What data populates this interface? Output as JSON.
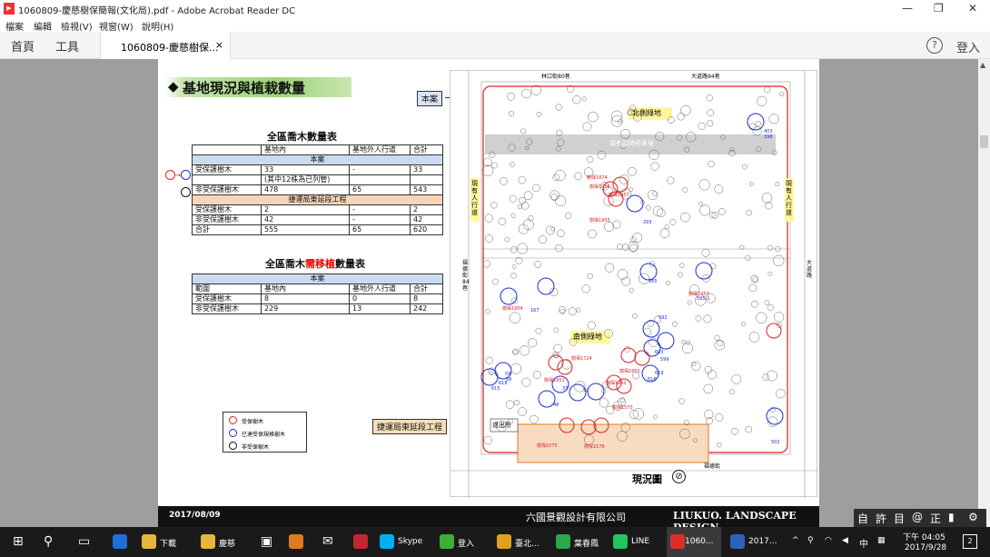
{
  "window": {
    "title": "1060809-慶慈樹保簡報(文化局).pdf - Adobe Acrobat Reader DC",
    "pdf_icon": "pdf-icon",
    "controls": [
      "—",
      "❐",
      "✕"
    ]
  },
  "menu": [
    "檔案",
    "編輯",
    "檢視(V)",
    "視窗(W)",
    "說明(H)"
  ],
  "toolbar": {
    "home": "首頁",
    "tools": "工具",
    "doc_tab": "1060809-慶慈樹保...",
    "doc_tab_close": "×",
    "help": "?",
    "login": "登入"
  },
  "slide": {
    "heading": "基地現況與植栽數量",
    "heading_mark": "◆",
    "table1": {
      "title": "全區喬木數量表",
      "headers": [
        "",
        "基地內",
        "基地外人行道",
        "合計"
      ],
      "section1": "本案",
      "rows1": [
        [
          "受保護樹木",
          "33",
          "-",
          "33"
        ],
        [
          "",
          "(其中12株為已列管)",
          "",
          ""
        ],
        [
          "非受保護樹木",
          "478",
          "65",
          "543"
        ]
      ],
      "section2": "捷運局東延段工程",
      "rows2": [
        [
          "受保護樹木",
          "2",
          "-",
          "2"
        ],
        [
          "非受保護樹木",
          "42",
          "-",
          "42"
        ],
        [
          "合計",
          "555",
          "65",
          "620"
        ]
      ]
    },
    "table2": {
      "title_prefix": "全區喬木",
      "title_highlight": "需移植",
      "title_suffix": "數量表",
      "section": "本案",
      "headers": [
        "範圍",
        "基地內",
        "基地外人行道",
        "合計"
      ],
      "rows": [
        [
          "受保護樹木",
          "8",
          "0",
          "8"
        ],
        [
          "非受保護樹木",
          "229",
          "13",
          "242"
        ]
      ]
    },
    "legend": [
      {
        "label": "受保樹木",
        "color": "#e02020"
      },
      {
        "label": "已達受保規格樹木",
        "color": "#1a2fd0"
      },
      {
        "label": "非受保樹木",
        "color": "#111111"
      }
    ],
    "map": {
      "callout_case": "本案",
      "callout_mrt": "捷運局東延段工程",
      "north_green": "北側綠地",
      "south_green": "南側綠地",
      "parking": "現有臨時停車場",
      "sidewalk_left": "現有人行道",
      "sidewalk_right": "現有人行道",
      "exit": "退出所",
      "street_top1": "林口街80巷",
      "street_top2": "大道路94巷",
      "street_left": "福德街84巷",
      "street_right": "大道路",
      "street_bottom": "福德街",
      "caption": "現況圖",
      "numbers": [
        "403",
        "398",
        "293",
        "565",
        "595-1",
        "167",
        "592",
        "603",
        "599",
        "619",
        "616",
        "618",
        "615",
        "92",
        "37",
        "48",
        "59",
        "58",
        "502"
      ],
      "red_labels": [
        "樹保1874",
        "樹保1956",
        "樹保1957",
        "樹保1955",
        "樹保1954",
        "樹保1953",
        "樹保1724",
        "樹保1950",
        "樹保1951",
        "樹保1952",
        "樹保1573",
        "樹保1575",
        "樹保1576"
      ]
    },
    "footer": {
      "date": "2017/08/09",
      "company": "六國景觀設計有限公司",
      "brand": "LIUKUO. LANDSCAPE DESIGN"
    }
  },
  "ime": [
    "自",
    "許",
    "目",
    "@",
    "正",
    "▮",
    "⚙"
  ],
  "taskbar": {
    "apps": [
      {
        "label": "",
        "name": "start-icon"
      },
      {
        "label": "",
        "name": "search-icon"
      },
      {
        "label": "",
        "name": "task-view-icon"
      },
      {
        "label": "",
        "name": "edge-icon"
      },
      {
        "label": "下載",
        "name": "folder-icon"
      },
      {
        "label": "慶慈",
        "name": "folder-icon"
      },
      {
        "label": "",
        "name": "store-icon"
      },
      {
        "label": "",
        "name": "paint-icon"
      },
      {
        "label": "",
        "name": "mail-icon"
      },
      {
        "label": "",
        "name": "red-app-icon"
      },
      {
        "label": "Skype",
        "name": "skype-icon"
      },
      {
        "label": "登入",
        "name": "wechat-icon"
      },
      {
        "label": "臺北...",
        "name": "chrome-icon"
      },
      {
        "label": "葉春鳳",
        "name": "contact-icon"
      },
      {
        "label": "LINE",
        "name": "line-icon"
      },
      {
        "label": "1060...",
        "name": "acrobat-icon"
      },
      {
        "label": "2017...",
        "name": "document-icon"
      }
    ],
    "tray": {
      "chevron": "^",
      "lang": "中",
      "time": "下午 04:05",
      "date": "2017/9/28",
      "notif": "2"
    }
  }
}
